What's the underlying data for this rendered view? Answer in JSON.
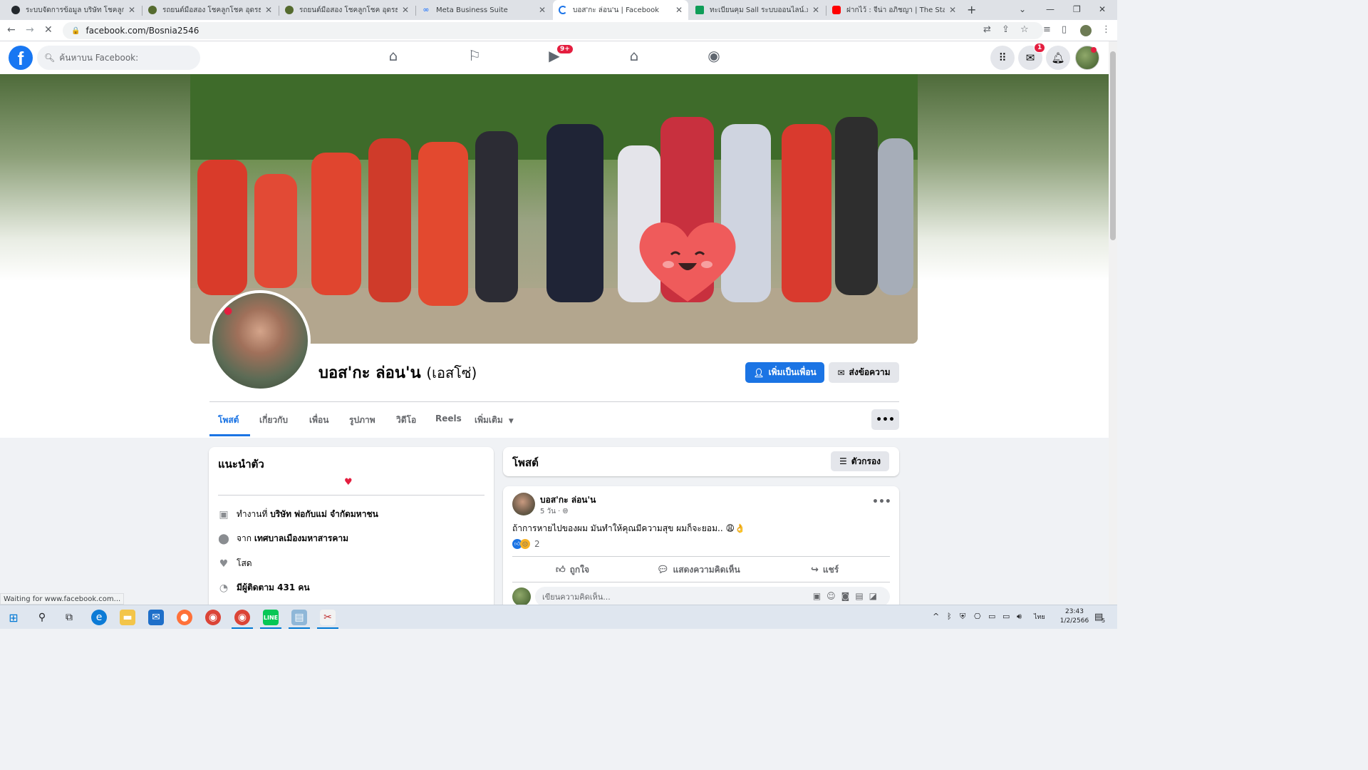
{
  "browser": {
    "tabs": [
      {
        "title": "ระบบจัดการข้อมูล บริษัท โชคลูกโชค",
        "icon": "github-icon",
        "color": "#24292e"
      },
      {
        "title": "รถยนต์มือสอง โชคลูกโชค อุดรธานี",
        "icon": "site-icon",
        "color": "#556b2f"
      },
      {
        "title": "รถยนต์มือสอง โชคลูกโชค อุดรธานี",
        "icon": "site-icon",
        "color": "#556b2f"
      },
      {
        "title": "Meta Business Suite",
        "icon": "meta-icon",
        "color": "#0866ff"
      },
      {
        "title": "บอส'กะ ล่อน'น | Facebook",
        "icon": "loading-icon",
        "color": "#1a73e8"
      },
      {
        "title": "ทะเบียนคุม Sall ระบบออนไลน์.xlsx -",
        "icon": "sheets-icon",
        "color": "#0f9d58"
      },
      {
        "title": "ฝากไว้ : จีน่า อภิชญา | The Star ค้นฯ",
        "icon": "youtube-icon",
        "color": "#ff0000"
      }
    ],
    "url": "facebook.com/Bosnia2546",
    "status_text": "Waiting for www.facebook.com..."
  },
  "fb_header": {
    "search_placeholder": "ค้นหาบน Facebook:",
    "logo": "f",
    "watch_badge": "9+",
    "messenger_badge": "1"
  },
  "profile": {
    "name": "บอส'กะ ล่อน'น",
    "alt_name": "(เอสโซ่)",
    "add_friend_label": "เพิ่มเป็นเพื่อน",
    "message_label": "ส่งข้อความ",
    "tabs": [
      "โพสต์",
      "เกี่ยวกับ",
      "เพื่อน",
      "รูปภาพ",
      "วิดีโอ",
      "Reels",
      "เพิ่มเติม"
    ]
  },
  "intro": {
    "title": "แนะนำตัว",
    "bio": "♥",
    "work_prefix": "ทำงานที่",
    "work_place": "บริษัท พ่อกับแม่ จำกัดมหาชน",
    "from_prefix": "จาก",
    "from_place": "เทศบาลเมืองมหาสารคาม",
    "relationship": "โสด",
    "followers": "มีผู้ติดตาม 431 คน"
  },
  "posts_section": {
    "title": "โพสต์",
    "filter_label": "ตัวกรอง"
  },
  "post": {
    "author": "บอส'กะ ล่อน'น",
    "time": "5 วัน ·",
    "text": "ถ้าการหายไปของผม มันทำให้คุณมีความสุข ผมก็จะยอม.. 😩👌",
    "reaction_count": "2",
    "like_label": "ถูกใจ",
    "comment_label": "แสดงความคิดเห็น",
    "share_label": "แชร์",
    "comment_placeholder": "เขียนความคิดเห็น..."
  },
  "taskbar": {
    "time": "23:43",
    "date": "1/2/2566",
    "lang": "ไทย",
    "notif_count": "5"
  },
  "colors": {
    "fb_blue": "#1b74e4",
    "badge_red": "#e41e3f"
  }
}
